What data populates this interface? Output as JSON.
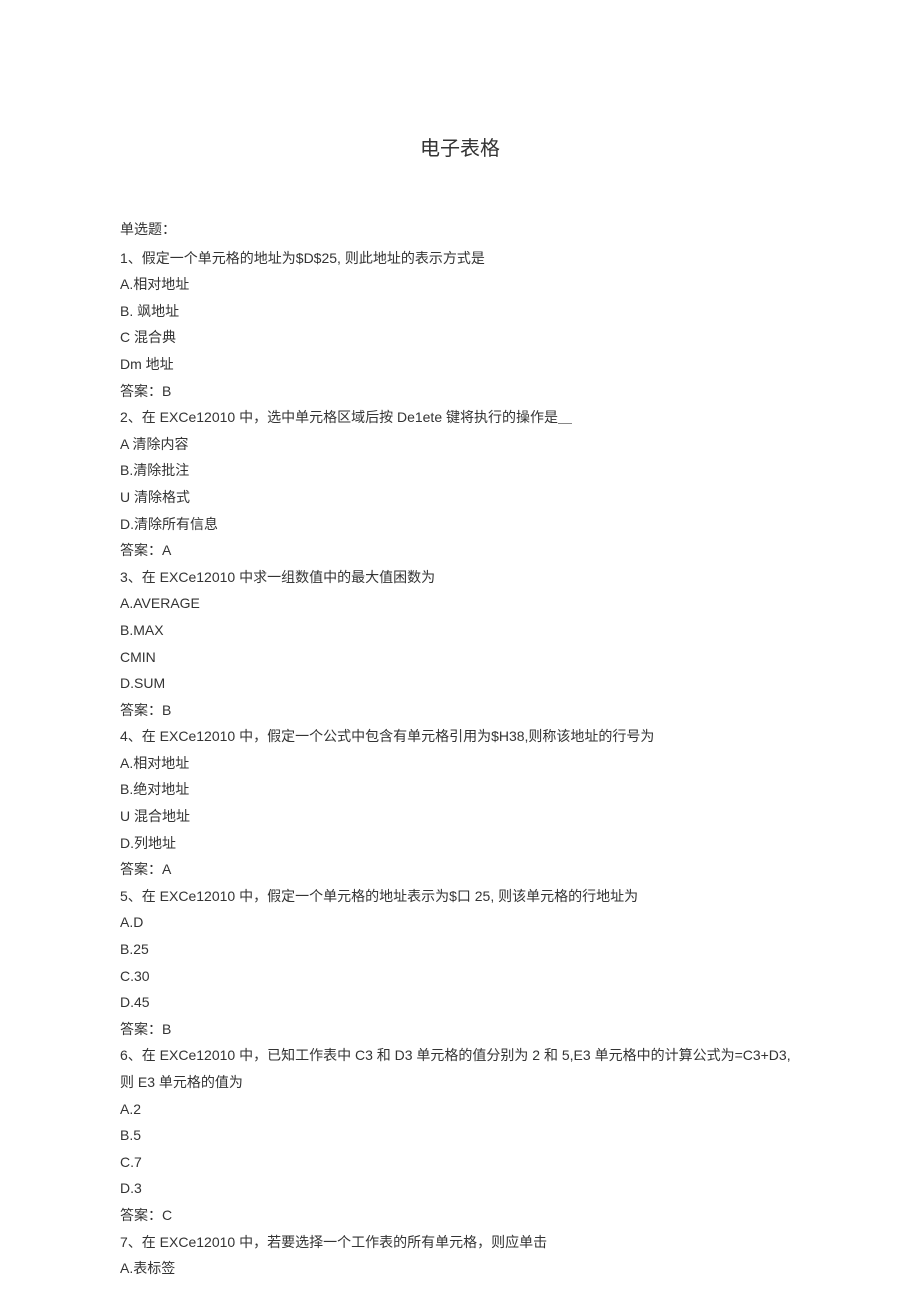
{
  "title": "电子表格",
  "sectionLabel": "单选题：",
  "questions": [
    {
      "stem": "1、假定一个单元格的地址为$D$25, 则此地址的表示方式是",
      "options": [
        "A.相对地址",
        "B. 飒地址",
        "C 混合典",
        "Dm 地址"
      ],
      "answer": "答案：B"
    },
    {
      "stem": "2、在 EXCe12010 中，选中单元格区域后按 De1ete 键将执行的操作是＿",
      "options": [
        "A 清除内容",
        "B.清除批注",
        "U 清除格式",
        "D.清除所有信息"
      ],
      "answer": "答案：A"
    },
    {
      "stem": "3、在 EXCe12010 中求一组数值中的最大值困数为",
      "options": [
        "A.AVERAGE",
        "B.MAX",
        "CMIN",
        "D.SUM"
      ],
      "answer": "答案：B"
    },
    {
      "stem": "4、在 EXCe12010 中，假定一个公式中包含有单元格引用为$H38,则称该地址的行号为",
      "options": [
        "A.相对地址",
        "B.绝对地址",
        "U 混合地址",
        "D.列地址"
      ],
      "answer": "答案：A"
    },
    {
      "stem": "5、在 EXCe12010 中，假定一个单元格的地址表示为$口 25, 则该单元格的行地址为",
      "options": [
        "A.D",
        "B.25",
        "C.30",
        "D.45"
      ],
      "answer": "答案：B"
    },
    {
      "stem": "6、在 EXCe12010 中，已知工作表中 C3 和 D3 单元格的值分别为 2 和 5,E3 单元格中的计算公式为=C3+D3, 则 E3 单元格的值为",
      "options": [
        "A.2",
        "B.5",
        "C.7",
        "D.3"
      ],
      "answer": "答案：C"
    },
    {
      "stem": "7、在 EXCe12010 中，若要选择一个工作表的所有单元格，则应单击",
      "options": [
        "A.表标签"
      ],
      "answer": ""
    }
  ]
}
